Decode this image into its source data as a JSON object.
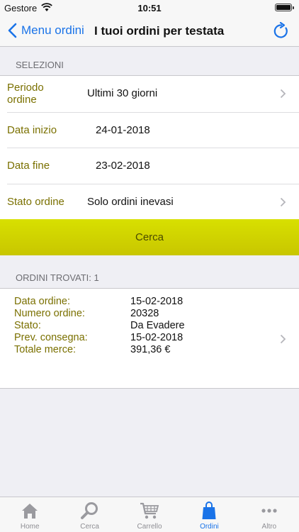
{
  "status_bar": {
    "carrier": "Gestore",
    "time": "10:51"
  },
  "nav": {
    "back_label": "Menu ordini",
    "title": "I tuoi ordini per testata"
  },
  "selections": {
    "header": "SELEZIONI",
    "periodo": {
      "label_line1": "Periodo",
      "label_line2": "ordine",
      "value": "Ultimi 30 giorni"
    },
    "data_inizio": {
      "label": "Data inizio",
      "value": "24-01-2018"
    },
    "data_fine": {
      "label": "Data fine",
      "value": "23-02-2018"
    },
    "stato": {
      "label": "Stato ordine",
      "value": "Solo ordini inevasi"
    }
  },
  "search_button": "Cerca",
  "results": {
    "header": "ORDINI TROVATI: 1",
    "order": {
      "data_label": "Data ordine:",
      "data_value": "15-02-2018",
      "numero_label": "Numero ordine:",
      "numero_value": "20328",
      "stato_label": "Stato:",
      "stato_value": "Da Evadere",
      "consegna_label": "Prev. consegna:",
      "consegna_value": "15-02-2018",
      "totale_label": "Totale merce:",
      "totale_value": "391,36 €"
    }
  },
  "tabs": [
    {
      "label": "Home",
      "icon": "home-icon"
    },
    {
      "label": "Cerca",
      "icon": "search-icon"
    },
    {
      "label": "Carrello",
      "icon": "cart-icon"
    },
    {
      "label": "Ordini",
      "icon": "bag-icon"
    },
    {
      "label": "Altro",
      "icon": "more-icon"
    }
  ],
  "colors": {
    "accent": "#1a73e8",
    "label_olive": "#7a7000",
    "button_yellow": "#d0d400"
  }
}
